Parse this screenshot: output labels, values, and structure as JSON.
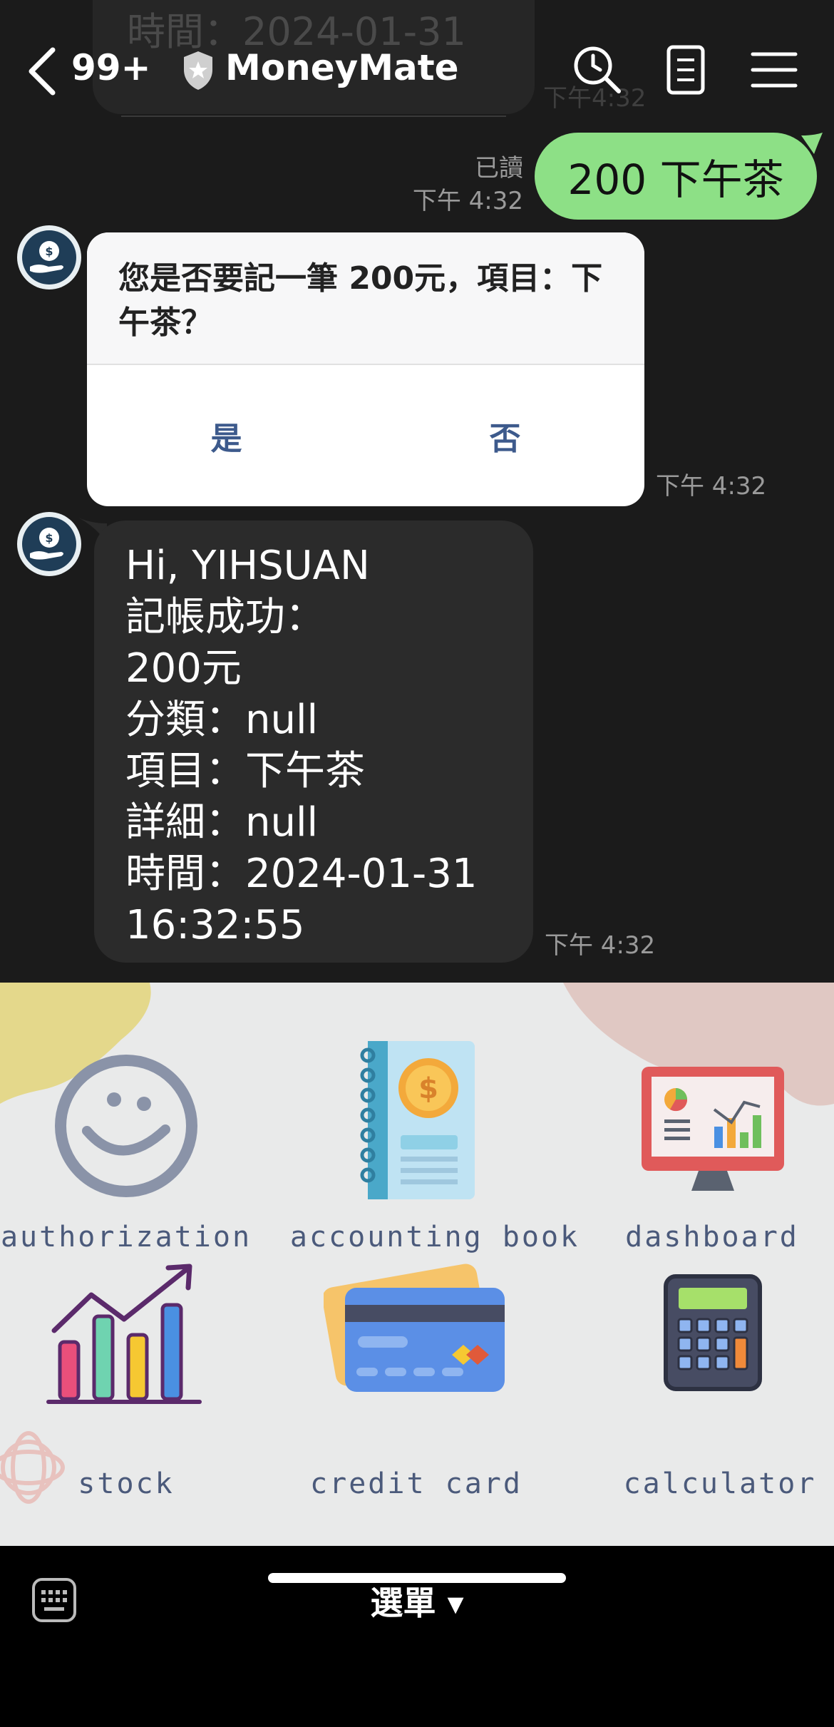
{
  "ghost": {
    "text": "時間：2024-01-31",
    "time": "下午4:32"
  },
  "header": {
    "unread_count": "99+",
    "title": "MoneyMate",
    "icons": [
      "back-icon",
      "shield-icon",
      "search-icon",
      "notes-icon",
      "menu-icon"
    ]
  },
  "messages": {
    "outgoing": {
      "read_label": "已讀",
      "time": "下午 4:32",
      "text": "200 下午茶"
    },
    "confirm": {
      "question": "您是否要記一筆 200元，項目：下午茶？",
      "yes_label": "是",
      "no_label": "否",
      "time": "下午 4:32"
    },
    "success": {
      "lines": [
        "Hi, YIHSUAN",
        "記帳成功：",
        "200元",
        "分類：null",
        "項目：下午茶",
        "詳細：null",
        "時間：2024-01-31",
        "16:32:55"
      ],
      "time": "下午 4:32"
    }
  },
  "rich_menu": {
    "items": [
      {
        "label": "authorization",
        "icon": "smiley-icon"
      },
      {
        "label": "accounting book",
        "icon": "notebook-icon"
      },
      {
        "label": "dashboard",
        "icon": "monitor-chart-icon"
      },
      {
        "label": "stock",
        "icon": "bar-chart-icon"
      },
      {
        "label": "credit card",
        "icon": "credit-card-icon"
      },
      {
        "label": "calculator",
        "icon": "calculator-icon"
      }
    ]
  },
  "bottom": {
    "menu_label": "選單 ▾",
    "keyboard_icon": "keyboard-icon"
  },
  "colors": {
    "outgoing_bubble": "#8de086",
    "incoming_bubble": "#2b2b2b",
    "accent_button": "#3d5a8c",
    "menu_label": "#4b5a7b"
  }
}
